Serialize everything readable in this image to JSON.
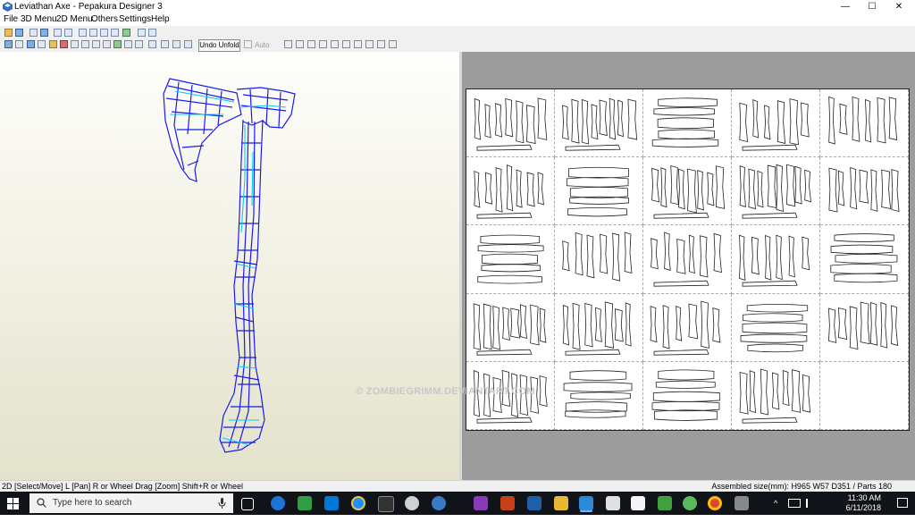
{
  "window": {
    "title": "Leviathan Axe - Pepakura Designer 3",
    "controls": {
      "minimize": "—",
      "maximize": "☐",
      "close": "✕"
    }
  },
  "menu": {
    "items": [
      "File",
      "3D Menu",
      "2D Menu",
      "Others",
      "Settings",
      "Help"
    ]
  },
  "toolbar": {
    "undo_unfold_label": "Undo Unfold",
    "auto_label": "Auto",
    "auto_checked": false
  },
  "view3d": {
    "model": "axe-wireframe",
    "colors": {
      "wire": "#1a1aee",
      "seam": "#00d0f0",
      "background": "#f3f2e6"
    }
  },
  "view2d": {
    "page_grid": {
      "columns": 5,
      "rows": 5,
      "empty_pages": [
        24
      ]
    },
    "watermark": "© ZOMBIEGRIMM.DEVIANTART.COM"
  },
  "statusbar": {
    "left": "2D [Select/Move] L [Pan] R or Wheel Drag [Zoom] Shift+R or Wheel",
    "right": "Assembled size(mm): H965 W57 D351 / Parts 180"
  },
  "taskbar": {
    "search_placeholder": "Type here to search",
    "time": "11:30 AM",
    "date": "6/11/2018",
    "apps": [
      "task-view",
      "edge",
      "green-app",
      "store",
      "ie",
      "app-dark",
      "app-circle",
      "app-dots",
      "app-red",
      "app-folder",
      "pepakura",
      "calculator",
      "notepad",
      "app-green2",
      "chrome",
      "app-gray"
    ]
  }
}
